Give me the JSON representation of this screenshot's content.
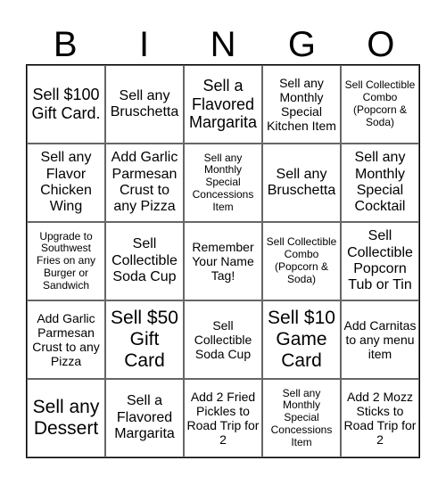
{
  "header": {
    "letters": [
      "B",
      "I",
      "N",
      "G",
      "O"
    ]
  },
  "board": {
    "cells": [
      [
        "Sell $100 Gift Card.",
        "Sell any Bruschetta",
        "Sell a Flavored Margarita",
        "Sell any Monthly Special Kitchen Item",
        "Sell Collectible Combo (Popcorn & Soda)"
      ],
      [
        "Sell any Flavor Chicken Wing",
        "Add Garlic Parmesan Crust to any Pizza",
        "Sell any Monthly Special Concessions Item",
        "Sell any Bruschetta",
        "Sell any Monthly Special Cocktail"
      ],
      [
        "Upgrade to Southwest Fries on any Burger or Sandwich",
        "Sell Collectible Soda Cup",
        "Remember Your Name Tag!",
        "Sell Collectible Combo (Popcorn & Soda)",
        "Sell Collectible Popcorn Tub or Tin"
      ],
      [
        "Add Garlic Parmesan Crust to any Pizza",
        "Sell $50 Gift Card",
        "Sell Collectible Soda Cup",
        "Sell $10 Game Card",
        "Add Carnitas to any menu item"
      ],
      [
        "Sell any Dessert",
        "Sell a Flavored Margarita",
        "Add 2 Fried Pickles to Road Trip for 2",
        "Sell any Monthly Special Concessions Item",
        "Add 2 Mozz Sticks to Road Trip for 2"
      ]
    ]
  }
}
